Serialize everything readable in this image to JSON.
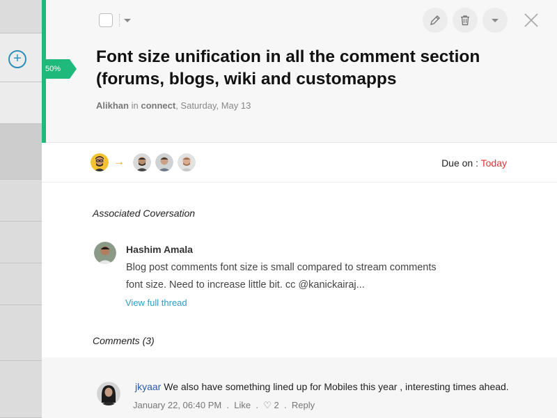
{
  "progress": {
    "label": "50%",
    "value": 0.5
  },
  "task": {
    "title": "Font size unification in all the comment section (forums, blogs, wiki and customapps",
    "author": "Alikhan",
    "in_word": "in",
    "group": "connect",
    "date": "Saturday, May 13"
  },
  "due": {
    "label": "Due on :",
    "value": "Today"
  },
  "associated": {
    "label": "Associated Coversation",
    "author": "Hashim Amala",
    "text": "Blog post comments font size is small compared to stream comments font size. Need to increase little bit. cc @kanickairaj...",
    "link": "View full thread"
  },
  "comments": {
    "label": "Comments (3)",
    "items": [
      {
        "user": "jkyaar",
        "text": "We also have something lined up for Mobiles this year , interesting times ahead.",
        "time": "January 22, 06:40 PM",
        "like": "Like",
        "likes": "2",
        "reply": "Reply"
      }
    ]
  },
  "icons": [
    "plus-circle-icon",
    "pencil-icon",
    "trash-icon",
    "chevron-down-icon",
    "close-icon",
    "arrow-right-icon",
    "heart-icon"
  ],
  "colors": {
    "accent_green": "#1fb97b",
    "due_today": "#e8312f",
    "link": "#2a9ec6",
    "arrow": "#f0a01e"
  }
}
